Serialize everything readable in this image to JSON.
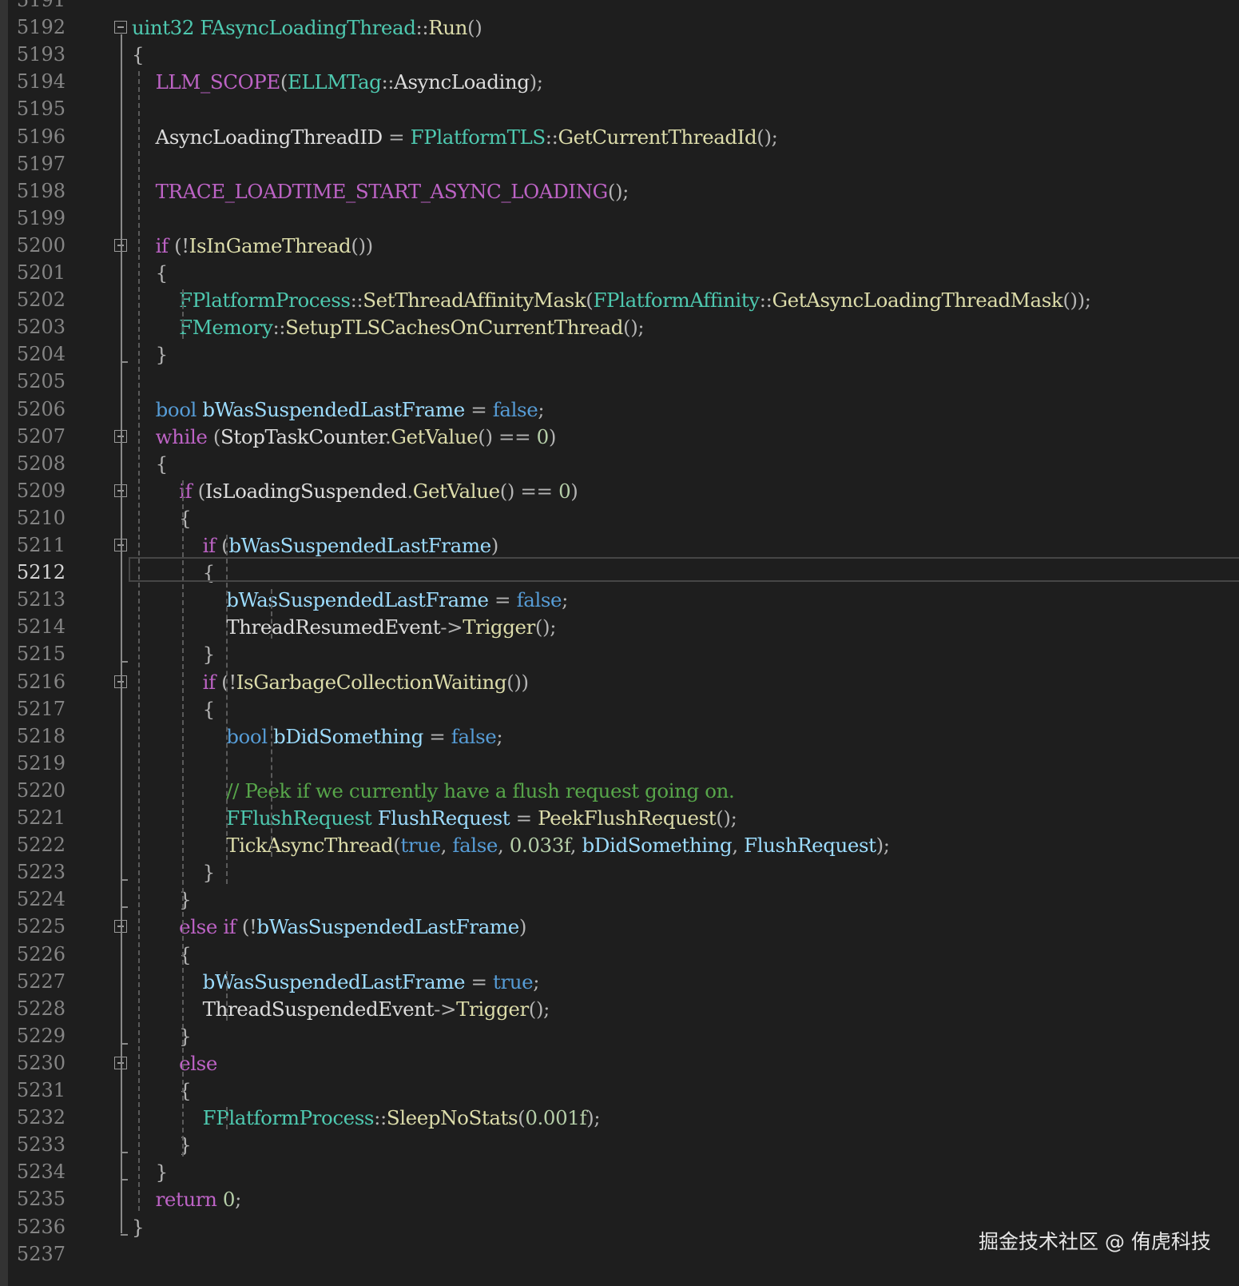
{
  "gutter": {
    "line_numbers": [
      "5191",
      "5192",
      "5193",
      "5194",
      "5195",
      "5196",
      "5197",
      "5198",
      "5199",
      "5200",
      "5201",
      "5202",
      "5203",
      "5204",
      "5205",
      "5206",
      "5207",
      "5208",
      "5209",
      "5210",
      "5211",
      "5212",
      "5213",
      "5214",
      "5215",
      "5216",
      "5217",
      "5218",
      "5219",
      "5220",
      "5221",
      "5222",
      "5223",
      "5224",
      "5225",
      "5226",
      "5227",
      "5228",
      "5229",
      "5230",
      "5231",
      "5232",
      "5233",
      "5234",
      "5235",
      "5236",
      "5237"
    ],
    "current_line": "5212"
  },
  "code": {
    "lines": [
      {
        "n": "5192",
        "tokens": [
          [
            "ty",
            "uint32"
          ],
          [
            "tx",
            " "
          ],
          [
            "ty",
            "FAsyncLoadingThread"
          ],
          [
            "pn",
            "::"
          ],
          [
            "fn",
            "Run"
          ],
          [
            "pn",
            "()"
          ]
        ]
      },
      {
        "n": "5193",
        "tokens": [
          [
            "pn",
            "{"
          ]
        ]
      },
      {
        "n": "5194",
        "tokens": [
          [
            "tx",
            "    "
          ],
          [
            "mac",
            "LLM_SCOPE"
          ],
          [
            "pn",
            "("
          ],
          [
            "ty",
            "ELLMTag"
          ],
          [
            "pn",
            "::"
          ],
          [
            "tx",
            "AsyncLoading"
          ],
          [
            "pn",
            ");"
          ]
        ]
      },
      {
        "n": "5195",
        "tokens": []
      },
      {
        "n": "5196",
        "tokens": [
          [
            "tx",
            "    AsyncLoadingThreadID "
          ],
          [
            "pn",
            "="
          ],
          [
            "tx",
            " "
          ],
          [
            "ty",
            "FPlatformTLS"
          ],
          [
            "pn",
            "::"
          ],
          [
            "fn",
            "GetCurrentThreadId"
          ],
          [
            "pn",
            "();"
          ]
        ]
      },
      {
        "n": "5197",
        "tokens": []
      },
      {
        "n": "5198",
        "tokens": [
          [
            "tx",
            "    "
          ],
          [
            "mac",
            "TRACE_LOADTIME_START_ASYNC_LOADING"
          ],
          [
            "pn",
            "();"
          ]
        ]
      },
      {
        "n": "5199",
        "tokens": []
      },
      {
        "n": "5200",
        "tokens": [
          [
            "tx",
            "    "
          ],
          [
            "mac",
            "if"
          ],
          [
            "tx",
            " "
          ],
          [
            "pn",
            "(!"
          ],
          [
            "fn",
            "IsInGameThread"
          ],
          [
            "pn",
            "())"
          ]
        ]
      },
      {
        "n": "5201",
        "tokens": [
          [
            "tx",
            "    "
          ],
          [
            "pn",
            "{"
          ]
        ]
      },
      {
        "n": "5202",
        "tokens": [
          [
            "tx",
            "        "
          ],
          [
            "ty",
            "FPlatformProcess"
          ],
          [
            "pn",
            "::"
          ],
          [
            "fn",
            "SetThreadAffinityMask"
          ],
          [
            "pn",
            "("
          ],
          [
            "ty",
            "FPlatformAffinity"
          ],
          [
            "pn",
            "::"
          ],
          [
            "fn",
            "GetAsyncLoadingThreadMask"
          ],
          [
            "pn",
            "());"
          ]
        ]
      },
      {
        "n": "5203",
        "tokens": [
          [
            "tx",
            "        "
          ],
          [
            "ty",
            "FMemory"
          ],
          [
            "pn",
            "::"
          ],
          [
            "fn",
            "SetupTLSCachesOnCurrentThread"
          ],
          [
            "pn",
            "();"
          ]
        ]
      },
      {
        "n": "5204",
        "tokens": [
          [
            "tx",
            "    "
          ],
          [
            "pn",
            "}"
          ]
        ]
      },
      {
        "n": "5205",
        "tokens": []
      },
      {
        "n": "5206",
        "tokens": [
          [
            "tx",
            "    "
          ],
          [
            "kw",
            "bool"
          ],
          [
            "tx",
            " "
          ],
          [
            "id",
            "bWasSuspendedLastFrame"
          ],
          [
            "tx",
            " "
          ],
          [
            "pn",
            "="
          ],
          [
            "tx",
            " "
          ],
          [
            "kw",
            "false"
          ],
          [
            "pn",
            ";"
          ]
        ]
      },
      {
        "n": "5207",
        "tokens": [
          [
            "tx",
            "    "
          ],
          [
            "mac",
            "while"
          ],
          [
            "tx",
            " "
          ],
          [
            "pn",
            "("
          ],
          [
            "tx",
            "StopTaskCounter"
          ],
          [
            "pn",
            "."
          ],
          [
            "fn",
            "GetValue"
          ],
          [
            "pn",
            "()"
          ],
          [
            "tx",
            " "
          ],
          [
            "pn",
            "=="
          ],
          [
            "tx",
            " "
          ],
          [
            "num",
            "0"
          ],
          [
            "pn",
            ")"
          ]
        ]
      },
      {
        "n": "5208",
        "tokens": [
          [
            "tx",
            "    "
          ],
          [
            "pn",
            "{"
          ]
        ]
      },
      {
        "n": "5209",
        "tokens": [
          [
            "tx",
            "        "
          ],
          [
            "mac",
            "if"
          ],
          [
            "tx",
            " "
          ],
          [
            "pn",
            "("
          ],
          [
            "tx",
            "IsLoadingSuspended"
          ],
          [
            "pn",
            "."
          ],
          [
            "fn",
            "GetValue"
          ],
          [
            "pn",
            "()"
          ],
          [
            "tx",
            " "
          ],
          [
            "pn",
            "=="
          ],
          [
            "tx",
            " "
          ],
          [
            "num",
            "0"
          ],
          [
            "pn",
            ")"
          ]
        ]
      },
      {
        "n": "5210",
        "tokens": [
          [
            "tx",
            "        "
          ],
          [
            "pn",
            "{"
          ]
        ]
      },
      {
        "n": "5211",
        "tokens": [
          [
            "tx",
            "            "
          ],
          [
            "mac",
            "if"
          ],
          [
            "tx",
            " "
          ],
          [
            "pn",
            "("
          ],
          [
            "id",
            "bWasSuspendedLastFrame"
          ],
          [
            "pn",
            ")"
          ]
        ]
      },
      {
        "n": "5212",
        "tokens": [
          [
            "tx",
            "            "
          ],
          [
            "pn",
            "{"
          ]
        ]
      },
      {
        "n": "5213",
        "tokens": [
          [
            "tx",
            "                "
          ],
          [
            "id",
            "bWasSuspendedLastFrame"
          ],
          [
            "tx",
            " "
          ],
          [
            "pn",
            "="
          ],
          [
            "tx",
            " "
          ],
          [
            "kw",
            "false"
          ],
          [
            "pn",
            ";"
          ]
        ]
      },
      {
        "n": "5214",
        "tokens": [
          [
            "tx",
            "                ThreadResumedEvent"
          ],
          [
            "pn",
            "->"
          ],
          [
            "fn",
            "Trigger"
          ],
          [
            "pn",
            "();"
          ]
        ]
      },
      {
        "n": "5215",
        "tokens": [
          [
            "tx",
            "            "
          ],
          [
            "pn",
            "}"
          ]
        ]
      },
      {
        "n": "5216",
        "tokens": [
          [
            "tx",
            "            "
          ],
          [
            "mac",
            "if"
          ],
          [
            "tx",
            " "
          ],
          [
            "pn",
            "(!"
          ],
          [
            "fn",
            "IsGarbageCollectionWaiting"
          ],
          [
            "pn",
            "())"
          ]
        ]
      },
      {
        "n": "5217",
        "tokens": [
          [
            "tx",
            "            "
          ],
          [
            "pn",
            "{"
          ]
        ]
      },
      {
        "n": "5218",
        "tokens": [
          [
            "tx",
            "                "
          ],
          [
            "kw",
            "bool"
          ],
          [
            "tx",
            " "
          ],
          [
            "id",
            "bDidSomething"
          ],
          [
            "tx",
            " "
          ],
          [
            "pn",
            "="
          ],
          [
            "tx",
            " "
          ],
          [
            "kw",
            "false"
          ],
          [
            "pn",
            ";"
          ]
        ]
      },
      {
        "n": "5219",
        "tokens": []
      },
      {
        "n": "5220",
        "tokens": [
          [
            "tx",
            "                "
          ],
          [
            "cmt",
            "// Peek if we currently have a flush request going on."
          ]
        ]
      },
      {
        "n": "5221",
        "tokens": [
          [
            "tx",
            "                "
          ],
          [
            "ty",
            "FFlushRequest"
          ],
          [
            "tx",
            " "
          ],
          [
            "id",
            "FlushRequest"
          ],
          [
            "tx",
            " "
          ],
          [
            "pn",
            "="
          ],
          [
            "tx",
            " "
          ],
          [
            "fn",
            "PeekFlushRequest"
          ],
          [
            "pn",
            "();"
          ]
        ]
      },
      {
        "n": "5222",
        "tokens": [
          [
            "tx",
            "                "
          ],
          [
            "fn",
            "TickAsyncThread"
          ],
          [
            "pn",
            "("
          ],
          [
            "kw",
            "true"
          ],
          [
            "pn",
            ","
          ],
          [
            "tx",
            " "
          ],
          [
            "kw",
            "false"
          ],
          [
            "pn",
            ","
          ],
          [
            "tx",
            " "
          ],
          [
            "num",
            "0.033f"
          ],
          [
            "pn",
            ","
          ],
          [
            "tx",
            " "
          ],
          [
            "id",
            "bDidSomething"
          ],
          [
            "pn",
            ","
          ],
          [
            "tx",
            " "
          ],
          [
            "id",
            "FlushRequest"
          ],
          [
            "pn",
            ");"
          ]
        ]
      },
      {
        "n": "5223",
        "tokens": [
          [
            "tx",
            "            "
          ],
          [
            "pn",
            "}"
          ]
        ]
      },
      {
        "n": "5224",
        "tokens": [
          [
            "tx",
            "        "
          ],
          [
            "pn",
            "}"
          ]
        ]
      },
      {
        "n": "5225",
        "tokens": [
          [
            "tx",
            "        "
          ],
          [
            "mac",
            "else"
          ],
          [
            "tx",
            " "
          ],
          [
            "mac",
            "if"
          ],
          [
            "tx",
            " "
          ],
          [
            "pn",
            "(!"
          ],
          [
            "id",
            "bWasSuspendedLastFrame"
          ],
          [
            "pn",
            ")"
          ]
        ]
      },
      {
        "n": "5226",
        "tokens": [
          [
            "tx",
            "        "
          ],
          [
            "pn",
            "{"
          ]
        ]
      },
      {
        "n": "5227",
        "tokens": [
          [
            "tx",
            "            "
          ],
          [
            "id",
            "bWasSuspendedLastFrame"
          ],
          [
            "tx",
            " "
          ],
          [
            "pn",
            "="
          ],
          [
            "tx",
            " "
          ],
          [
            "kw",
            "true"
          ],
          [
            "pn",
            ";"
          ]
        ]
      },
      {
        "n": "5228",
        "tokens": [
          [
            "tx",
            "            ThreadSuspendedEvent"
          ],
          [
            "pn",
            "->"
          ],
          [
            "fn",
            "Trigger"
          ],
          [
            "pn",
            "();"
          ]
        ]
      },
      {
        "n": "5229",
        "tokens": [
          [
            "tx",
            "        "
          ],
          [
            "pn",
            "}"
          ]
        ]
      },
      {
        "n": "5230",
        "tokens": [
          [
            "tx",
            "        "
          ],
          [
            "mac",
            "else"
          ]
        ]
      },
      {
        "n": "5231",
        "tokens": [
          [
            "tx",
            "        "
          ],
          [
            "pn",
            "{"
          ]
        ]
      },
      {
        "n": "5232",
        "tokens": [
          [
            "tx",
            "            "
          ],
          [
            "ty",
            "FPlatformProcess"
          ],
          [
            "pn",
            "::"
          ],
          [
            "fn",
            "SleepNoStats"
          ],
          [
            "pn",
            "("
          ],
          [
            "num",
            "0.001f"
          ],
          [
            "pn",
            ");"
          ]
        ]
      },
      {
        "n": "5233",
        "tokens": [
          [
            "tx",
            "        "
          ],
          [
            "pn",
            "}"
          ]
        ]
      },
      {
        "n": "5234",
        "tokens": [
          [
            "tx",
            "    "
          ],
          [
            "pn",
            "}"
          ]
        ]
      },
      {
        "n": "5235",
        "tokens": [
          [
            "tx",
            "    "
          ],
          [
            "mac",
            "return"
          ],
          [
            "tx",
            " "
          ],
          [
            "num",
            "0"
          ],
          [
            "pn",
            ";"
          ]
        ]
      },
      {
        "n": "5236",
        "tokens": [
          [
            "pn",
            "}"
          ]
        ]
      }
    ]
  },
  "watermark": {
    "text": "掘金技术社区 @ 侑虎科技"
  },
  "colors": {
    "background": "#1e1e1e",
    "line_number": "#858585",
    "keyword": "#569cd6",
    "type": "#4ec9b0",
    "function": "#dcdcaa",
    "identifier": "#9cdcfe",
    "macro_control": "#bd63c5",
    "number": "#b5cea8",
    "comment": "#57a64a",
    "text": "#dcdcdc"
  },
  "icons": {
    "fold_toggle": "collapse-minus-icon"
  }
}
